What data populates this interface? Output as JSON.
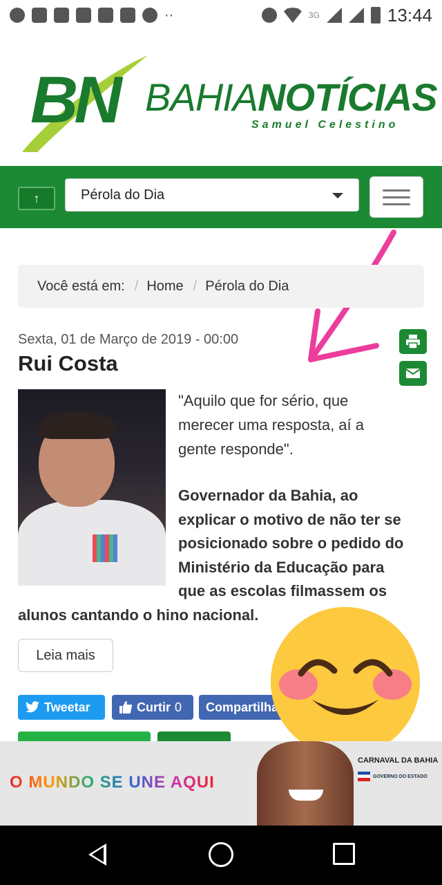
{
  "status_bar": {
    "time": "13:44",
    "network_label": "3G",
    "icons": [
      "chrome-icon",
      "message-icon",
      "facebook-icon",
      "gmail-icon",
      "missed-call-icon",
      "gallery-icon",
      "pinwheel-icon",
      "more-dots-icon",
      "alarm-icon",
      "wifi-icon",
      "signal-icon",
      "battery-icon"
    ]
  },
  "logo": {
    "initials": "BN",
    "name_thin": "BAHIA",
    "name_bold": "NOTÍCIAS",
    "subtitle": "Samuel Celestino",
    "color": "#1a7a2e"
  },
  "navbar": {
    "color": "#1c8a34",
    "selected_section": "Pérola do Dia"
  },
  "breadcrumb": {
    "prefix": "Você está em:",
    "items": [
      "Home",
      "Pérola do Dia"
    ]
  },
  "article": {
    "date": "Sexta, 01 de Março de 2019 - 00:00",
    "title": "Rui Costa",
    "quote_lines": [
      "\"Aquilo que for sério, que",
      "merecer uma resposta, aí a",
      "gente responde\"."
    ],
    "body_lines": [
      "Governador da Bahia, ao",
      "explicar o motivo de não ter se",
      "posicionado sobre o pedido do",
      "Ministério da Educação para",
      "que as escolas filmassem os",
      "alunos cantando o hino nacional."
    ],
    "read_more": "Leia mais"
  },
  "share": {
    "tweet": "Tweetar",
    "like": "Curtir",
    "like_count": "0",
    "share": "Compartilhar"
  },
  "banner": {
    "slogan": "O MUNDO SE UNE AQUI",
    "event": "CARNAVAL DA BAHIA",
    "sponsor": "GOVERNO DO ESTADO"
  }
}
